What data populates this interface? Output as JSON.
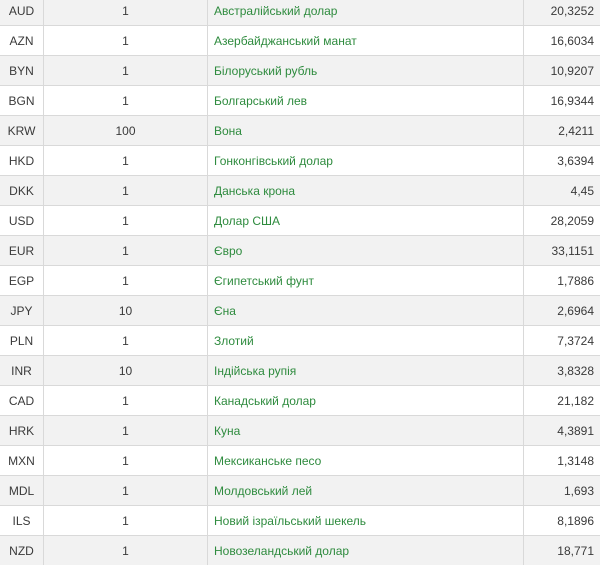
{
  "rates": [
    {
      "code": "AUD",
      "units": "1",
      "name": "Австралійський долар",
      "rate": "20,3252"
    },
    {
      "code": "AZN",
      "units": "1",
      "name": "Азербайджанський манат",
      "rate": "16,6034"
    },
    {
      "code": "BYN",
      "units": "1",
      "name": "Білоруський рубль",
      "rate": "10,9207"
    },
    {
      "code": "BGN",
      "units": "1",
      "name": "Болгарський лев",
      "rate": "16,9344"
    },
    {
      "code": "KRW",
      "units": "100",
      "name": "Вона",
      "rate": "2,4211"
    },
    {
      "code": "HKD",
      "units": "1",
      "name": "Гонконгівський долар",
      "rate": "3,6394"
    },
    {
      "code": "DKK",
      "units": "1",
      "name": "Данська крона",
      "rate": "4,45"
    },
    {
      "code": "USD",
      "units": "1",
      "name": "Долар США",
      "rate": "28,2059"
    },
    {
      "code": "EUR",
      "units": "1",
      "name": "Євро",
      "rate": "33,1151"
    },
    {
      "code": "EGP",
      "units": "1",
      "name": "Єгипетський фунт",
      "rate": "1,7886"
    },
    {
      "code": "JPY",
      "units": "10",
      "name": "Єна",
      "rate": "2,6964"
    },
    {
      "code": "PLN",
      "units": "1",
      "name": "Злотий",
      "rate": "7,3724"
    },
    {
      "code": "INR",
      "units": "10",
      "name": "Індійська рупія",
      "rate": "3,8328"
    },
    {
      "code": "CAD",
      "units": "1",
      "name": "Канадський долар",
      "rate": "21,182"
    },
    {
      "code": "HRK",
      "units": "1",
      "name": "Куна",
      "rate": "4,3891"
    },
    {
      "code": "MXN",
      "units": "1",
      "name": "Мексиканське песо",
      "rate": "1,3148"
    },
    {
      "code": "MDL",
      "units": "1",
      "name": "Молдовський лей",
      "rate": "1,693"
    },
    {
      "code": "ILS",
      "units": "1",
      "name": "Новий ізраїльський шекель",
      "rate": "8,1896"
    },
    {
      "code": "NZD",
      "units": "1",
      "name": "Новозеландський долар",
      "rate": "18,771"
    }
  ],
  "colors": {
    "link": "#2e8b3e",
    "stripe": "#f2f2f2",
    "border": "#d9d9d9",
    "text": "#3a3a3a"
  }
}
